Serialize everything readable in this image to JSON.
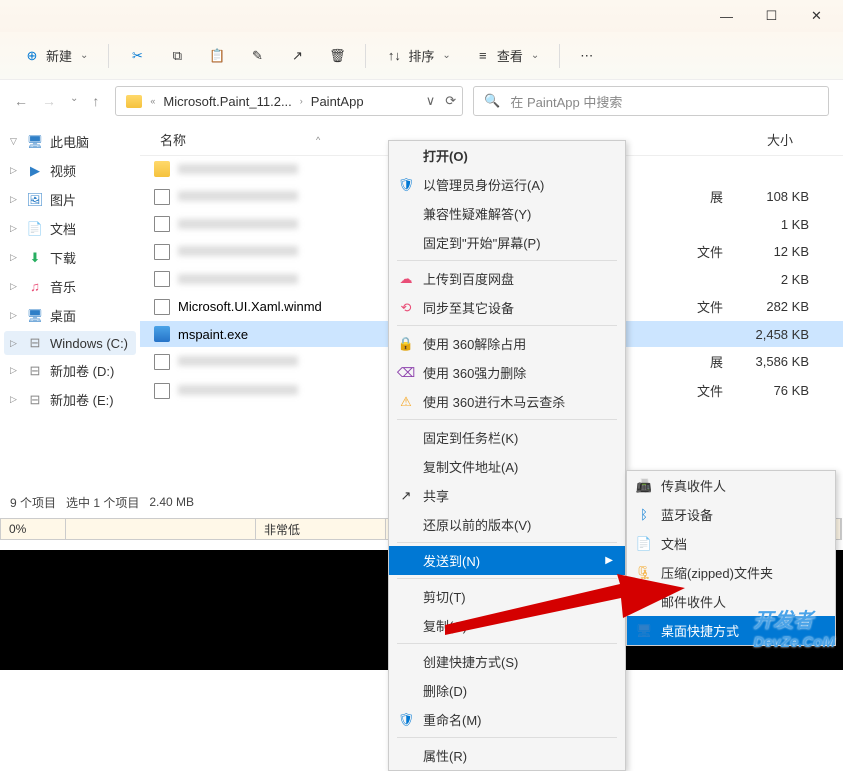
{
  "titlebar": {
    "min": "—",
    "max": "☐",
    "close": "✕"
  },
  "toolbar": {
    "new": "新建",
    "sort": "排序",
    "view": "查看",
    "more": "⋯"
  },
  "nav": {
    "back": "←",
    "fwd": "→",
    "up": "↑"
  },
  "path": {
    "chev_left": "«",
    "seg1": "Microsoft.Paint_11.2...",
    "seg2": "PaintApp",
    "dd": "∨",
    "refresh": "⟳"
  },
  "search": {
    "icon": "🔍",
    "placeholder": "在 PaintApp 中搜索"
  },
  "columns": {
    "name": "名称",
    "sort_ind": "^",
    "size": "大小"
  },
  "sidebar": {
    "items": [
      {
        "icon": "🖥",
        "color": "#2f7fc7",
        "label": "此电脑",
        "chev": "▽",
        "sel": false
      },
      {
        "icon": "▶",
        "color": "#2f7fc7",
        "label": "视频",
        "chev": "▷",
        "sel": false
      },
      {
        "icon": "🖼",
        "color": "#2f7fc7",
        "label": "图片",
        "chev": "▷",
        "sel": false
      },
      {
        "icon": "📄",
        "color": "#2f7fc7",
        "label": "文档",
        "chev": "▷",
        "sel": false
      },
      {
        "icon": "⬇",
        "color": "#27ae60",
        "label": "下载",
        "chev": "▷",
        "sel": false
      },
      {
        "icon": "♫",
        "color": "#e94e77",
        "label": "音乐",
        "chev": "▷",
        "sel": false
      },
      {
        "icon": "🖥",
        "color": "#2f7fc7",
        "label": "桌面",
        "chev": "▷",
        "sel": false
      },
      {
        "icon": "⊟",
        "color": "#888",
        "label": "Windows (C:)",
        "chev": "▷",
        "sel": true
      },
      {
        "icon": "⊟",
        "color": "#888",
        "label": "新加卷 (D:)",
        "chev": "▷",
        "sel": false
      },
      {
        "icon": "⊟",
        "color": "#888",
        "label": "新加卷 (E:)",
        "chev": "▷",
        "sel": false
      }
    ]
  },
  "files": {
    "rows": [
      {
        "type": "folder",
        "name": "",
        "ext": "",
        "size": "",
        "sel": false,
        "blur": true
      },
      {
        "type": "file",
        "name": "",
        "ext": "展",
        "size": "108 KB",
        "sel": false,
        "blur": true
      },
      {
        "type": "file",
        "name": "",
        "ext": "",
        "size": "1 KB",
        "sel": false,
        "blur": true
      },
      {
        "type": "file",
        "name": "",
        "ext": "文件",
        "size": "12 KB",
        "sel": false,
        "blur": true
      },
      {
        "type": "file",
        "name": "",
        "ext": "",
        "size": "2 KB",
        "sel": false,
        "blur": true
      },
      {
        "type": "file",
        "name": "Microsoft.UI.Xaml.winmd",
        "ext": "文件",
        "size": "282 KB",
        "sel": false,
        "blur": false
      },
      {
        "type": "app",
        "name": "mspaint.exe",
        "ext": "",
        "size": "2,458 KB",
        "sel": true,
        "blur": false
      },
      {
        "type": "file",
        "name": "",
        "ext": "展",
        "size": "3,586 KB",
        "sel": false,
        "blur": true
      },
      {
        "type": "file",
        "name": "",
        "ext": "文件",
        "size": "76 KB",
        "sel": false,
        "blur": true
      }
    ]
  },
  "status": {
    "items": "9 个项目",
    "selected": "选中 1 个项目",
    "size": "2.40 MB"
  },
  "progress": {
    "pct": "0%",
    "level": "非常低"
  },
  "context_menu": {
    "open": "打开(O)",
    "admin": "以管理员身份运行(A)",
    "compat": "兼容性疑难解答(Y)",
    "pin_start": "固定到\"开始\"屏幕(P)",
    "baidu": "上传到百度网盘",
    "sync": "同步至其它设备",
    "unblock360": "使用 360解除占用",
    "force360": "使用 360强力删除",
    "scan360": "使用 360进行木马云查杀",
    "pin_taskbar": "固定到任务栏(K)",
    "copy_path": "复制文件地址(A)",
    "share": "共享",
    "previous": "还原以前的版本(V)",
    "send_to": "发送到(N)",
    "cut": "剪切(T)",
    "copy": "复制(C)",
    "shortcut": "创建快捷方式(S)",
    "delete": "删除(D)",
    "rename": "重命名(M)",
    "properties": "属性(R)"
  },
  "send_to_menu": {
    "fax": "传真收件人",
    "bluetooth": "蓝牙设备",
    "documents": "文档",
    "zip": "压缩(zipped)文件夹",
    "mail": "邮件收件人",
    "desktop": "桌面快捷方式"
  },
  "watermark": {
    "l1": "开发者",
    "l2": "DevZe.CoM"
  }
}
